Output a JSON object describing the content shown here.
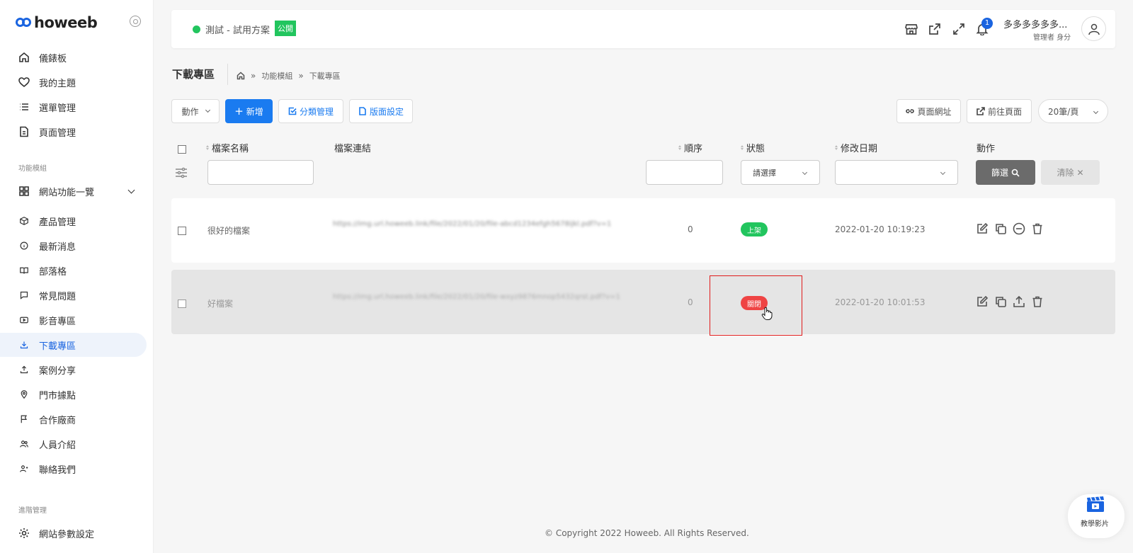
{
  "brand": {
    "logo_text": "howeeb",
    "color": "#1a64e0"
  },
  "sidebar": {
    "items": [
      {
        "label": "儀錶板",
        "icon": "home-icon"
      },
      {
        "label": "我的主題",
        "icon": "heart-icon"
      },
      {
        "label": "選單管理",
        "icon": "list-icon"
      },
      {
        "label": "頁面管理",
        "icon": "file-icon"
      }
    ],
    "section_modules": "功能模組",
    "modules_group": {
      "label": "網站功能一覽",
      "icon": "grid-icon"
    },
    "modules": [
      {
        "label": "產品管理",
        "icon": "box-icon"
      },
      {
        "label": "最新消息",
        "icon": "info-icon"
      },
      {
        "label": "部落格",
        "icon": "book-icon"
      },
      {
        "label": "常見問題",
        "icon": "message-icon"
      },
      {
        "label": "影音專區",
        "icon": "video-icon"
      },
      {
        "label": "下載專區",
        "icon": "download-icon",
        "active": true
      },
      {
        "label": "案例分享",
        "icon": "share-icon"
      },
      {
        "label": "門市據點",
        "icon": "map-pin-icon"
      },
      {
        "label": "合作廠商",
        "icon": "flag-icon"
      },
      {
        "label": "人員介紹",
        "icon": "users-icon"
      },
      {
        "label": "聯絡我們",
        "icon": "user-contact-icon"
      }
    ],
    "section_advanced": "進階管理",
    "advanced": [
      {
        "label": "網站參數設定",
        "icon": "gear-icon"
      }
    ]
  },
  "topbar": {
    "site_name": "測試 - 試用方案",
    "public_badge": "公開",
    "notification_count": "1",
    "user_name": "多多多多多多...",
    "user_role": "管理者 身分"
  },
  "page": {
    "title": "下載專區",
    "breadcrumb": [
      "功能模組",
      "下載專區"
    ]
  },
  "toolbar": {
    "action_label": "動作",
    "add_label": "新增",
    "category_label": "分類管理",
    "layout_label": "版面設定",
    "page_url_label": "頁面網址",
    "goto_page_label": "前往頁面",
    "per_page": "20筆/頁"
  },
  "table": {
    "columns": {
      "name": "檔案名稱",
      "link": "檔案連結",
      "order": "順序",
      "status": "狀態",
      "modified": "修改日期",
      "actions": "動作"
    },
    "filters": {
      "status_placeholder": "請選擇",
      "filter_button": "篩選",
      "clear_button": "清除"
    },
    "rows": [
      {
        "name": "很好的檔案",
        "link": "https://img.url.howeeb.link/file/2022/01/20/file-abcd1234efgh5678ijkl.pdf?v=1",
        "order": "0",
        "status": "上架",
        "status_color": "#22c55e",
        "modified": "2022-01-20 10:19:23"
      },
      {
        "name": "好檔案",
        "link": "https://img.url.howeeb.link/file/2022/01/20/file-wxyz9876mnop5432qrst.pdf?v=1",
        "order": "0",
        "status": "關閉",
        "status_color": "#ef4444",
        "modified": "2022-01-20 10:01:53"
      }
    ]
  },
  "footer": {
    "copyright": "© Copyright 2022 Howeeb. All Rights Reserved."
  },
  "tutorial": {
    "label": "教學影片"
  }
}
